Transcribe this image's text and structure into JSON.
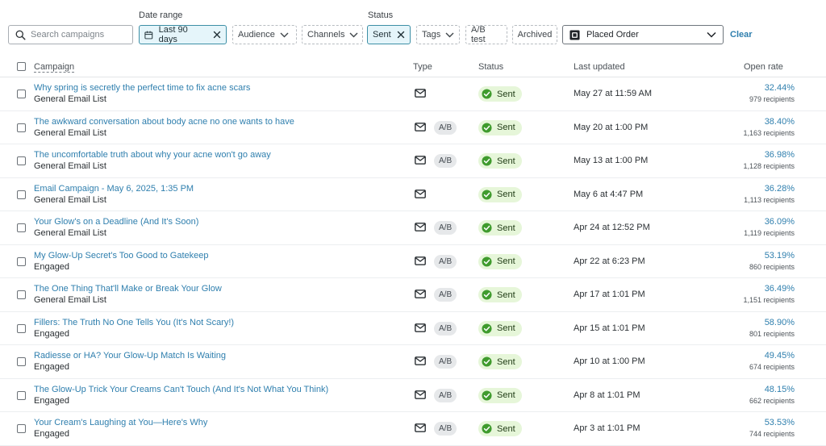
{
  "filters": {
    "search_placeholder": "Search campaigns",
    "date_range_label": "Date range",
    "date_range_value": "Last 90 days",
    "audience": "Audience",
    "channels": "Channels",
    "status_label": "Status",
    "status_value": "Sent",
    "tags": "Tags",
    "ab_test": "A/B test",
    "archived": "Archived",
    "metric_select": "Placed Order",
    "clear": "Clear"
  },
  "table": {
    "headers": {
      "campaign": "Campaign",
      "type": "Type",
      "status": "Status",
      "last_updated": "Last updated",
      "open_rate": "Open rate"
    },
    "rows": [
      {
        "title": "Why spring is secretly the perfect time to fix acne scars",
        "list": "General Email List",
        "ab": "",
        "status": "Sent",
        "updated": "May 27 at 11:59 AM",
        "open_rate": "32.44%",
        "recipients": "979 recipients"
      },
      {
        "title": "The awkward conversation about body acne no one wants to have",
        "list": "General Email List",
        "ab": "A/B",
        "status": "Sent",
        "updated": "May 20 at 1:00 PM",
        "open_rate": "38.40%",
        "recipients": "1,163 recipients"
      },
      {
        "title": "The uncomfortable truth about why your acne won't go away",
        "list": "General Email List",
        "ab": "A/B",
        "status": "Sent",
        "updated": "May 13 at 1:00 PM",
        "open_rate": "36.98%",
        "recipients": "1,128 recipients"
      },
      {
        "title": "Email Campaign - May 6, 2025, 1:35 PM",
        "list": "General Email List",
        "ab": "",
        "status": "Sent",
        "updated": "May 6 at 4:47 PM",
        "open_rate": "36.28%",
        "recipients": "1,113 recipients"
      },
      {
        "title": "Your Glow's on a Deadline (And It's Soon)",
        "list": "General Email List",
        "ab": "A/B",
        "status": "Sent",
        "updated": "Apr 24 at 12:52 PM",
        "open_rate": "36.09%",
        "recipients": "1,119 recipients"
      },
      {
        "title": "My Glow-Up Secret's Too Good to Gatekeep",
        "list": "Engaged",
        "ab": "A/B",
        "status": "Sent",
        "updated": "Apr 22 at 6:23 PM",
        "open_rate": "53.19%",
        "recipients": "860 recipients"
      },
      {
        "title": "The One Thing That'll Make or Break Your Glow",
        "list": "General Email List",
        "ab": "A/B",
        "status": "Sent",
        "updated": "Apr 17 at 1:01 PM",
        "open_rate": "36.49%",
        "recipients": "1,151 recipients"
      },
      {
        "title": "Fillers: The Truth No One Tells You (It's Not Scary!)",
        "list": "Engaged",
        "ab": "A/B",
        "status": "Sent",
        "updated": "Apr 15 at 1:01 PM",
        "open_rate": "58.90%",
        "recipients": "801 recipients"
      },
      {
        "title": "Radiesse or HA? Your Glow-Up Match Is Waiting",
        "list": "Engaged",
        "ab": "A/B",
        "status": "Sent",
        "updated": "Apr 10 at 1:00 PM",
        "open_rate": "49.45%",
        "recipients": "674 recipients"
      },
      {
        "title": "The Glow-Up Trick Your Creams Can't Touch (And It's Not What You Think)",
        "list": "Engaged",
        "ab": "A/B",
        "status": "Sent",
        "updated": "Apr 8 at 1:01 PM",
        "open_rate": "48.15%",
        "recipients": "662 recipients"
      },
      {
        "title": "Your Cream's Laughing at You—Here's Why",
        "list": "Engaged",
        "ab": "A/B",
        "status": "Sent",
        "updated": "Apr 3 at 1:01 PM",
        "open_rate": "53.53%",
        "recipients": "744 recipients"
      }
    ]
  },
  "colors": {
    "link": "#2f7fae",
    "sent_badge_bg": "#e6f6d9",
    "sent_icon": "#3f9b2d",
    "active_chip_bg": "#e5f5fa",
    "active_chip_border": "#3d8fa6"
  },
  "icons": {
    "search": "search-icon",
    "calendar": "calendar-icon",
    "close": "close-icon",
    "chevron": "chevron-down-icon",
    "metric": "metric-square-icon",
    "email": "email-icon",
    "sent": "check-circle-icon"
  }
}
